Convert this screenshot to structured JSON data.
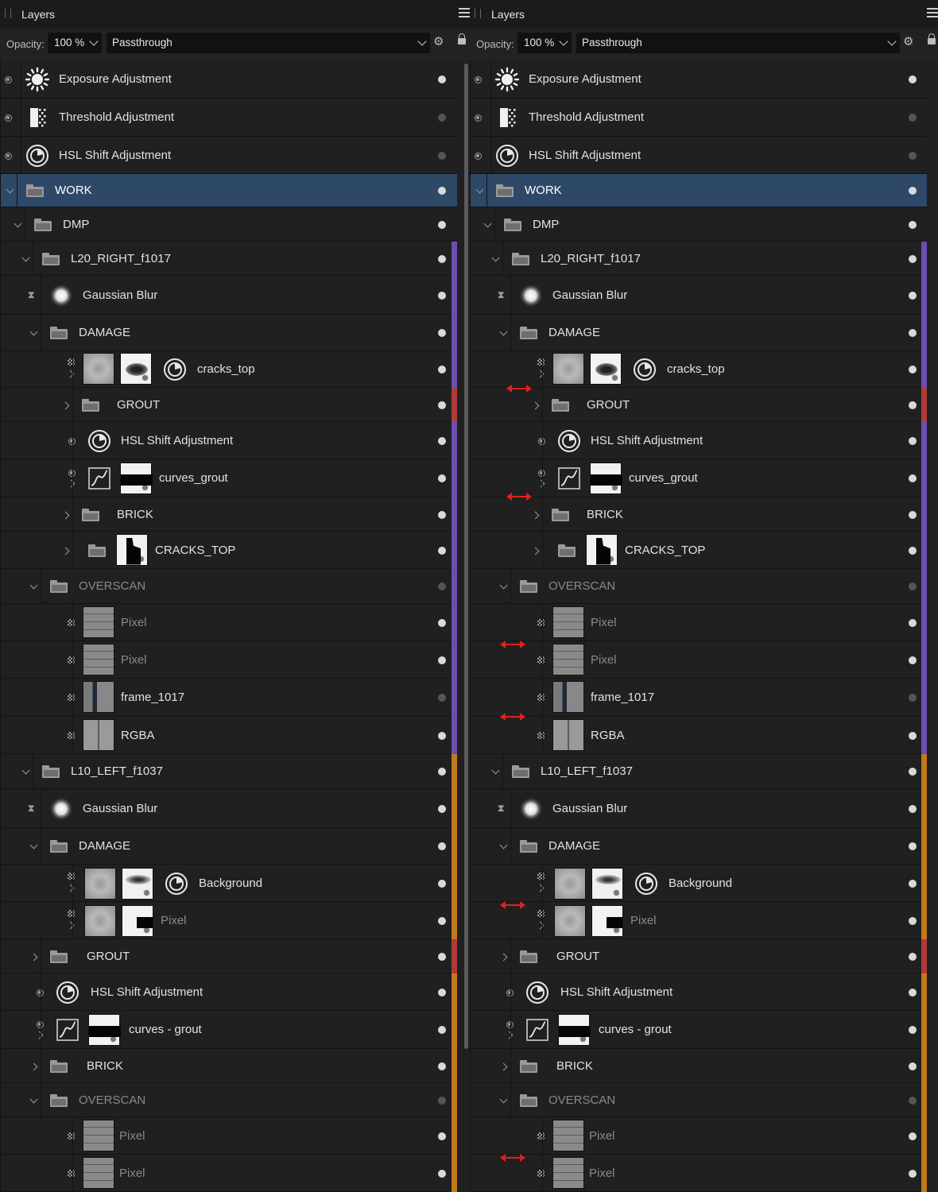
{
  "colors": {
    "selected_row": "#2e4868",
    "tag_purple": "#6b4fb0",
    "tag_red": "#b03a3a",
    "tag_orange": "#c07a1c",
    "arrow": "#e02020"
  },
  "panels": [
    {
      "title": "Layers",
      "opacity_label": "Opacity:",
      "opacity_value": "100 %",
      "blend_mode": "Passthrough",
      "layers": [
        {
          "name": "Exposure Adjustment",
          "icon": "exposure-icon"
        },
        {
          "name": "Threshold Adjustment",
          "icon": "threshold-icon"
        },
        {
          "name": "HSL Shift Adjustment",
          "icon": "hsl-icon"
        },
        {
          "name": "WORK",
          "icon": "folder-icon",
          "selected": true
        },
        {
          "name": "DMP",
          "icon": "folder-icon"
        },
        {
          "name": "L20_RIGHT_f1017",
          "icon": "folder-icon"
        },
        {
          "name": "Gaussian Blur",
          "icon": "blur-icon"
        },
        {
          "name": "DAMAGE",
          "icon": "folder-icon"
        },
        {
          "name": "cracks_top",
          "icon": "hsl-icon"
        },
        {
          "name": "GROUT",
          "icon": "folder-icon"
        },
        {
          "name": "HSL Shift Adjustment",
          "icon": "hsl-icon"
        },
        {
          "name": "curves_grout",
          "icon": "curves-icon"
        },
        {
          "name": "BRICK",
          "icon": "folder-icon"
        },
        {
          "name": "CRACKS_TOP",
          "icon": "folder-icon"
        },
        {
          "name": "OVERSCAN",
          "icon": "folder-icon"
        },
        {
          "name": "Pixel",
          "icon": "pixel-thumb"
        },
        {
          "name": "Pixel",
          "icon": "pixel-thumb"
        },
        {
          "name": "frame_1017",
          "icon": "frame-thumb"
        },
        {
          "name": "RGBA",
          "icon": "rgba-thumb"
        },
        {
          "name": "L10_LEFT_f1037",
          "icon": "folder-icon"
        },
        {
          "name": "Gaussian Blur",
          "icon": "blur-icon"
        },
        {
          "name": "DAMAGE",
          "icon": "folder-icon"
        },
        {
          "name": "Background",
          "icon": "hsl-icon"
        },
        {
          "name": "Pixel",
          "icon": "pixel-thumb"
        },
        {
          "name": "GROUT",
          "icon": "folder-icon"
        },
        {
          "name": "HSL Shift Adjustment",
          "icon": "hsl-icon"
        },
        {
          "name": "curves - grout",
          "icon": "curves-icon"
        },
        {
          "name": "BRICK",
          "icon": "folder-icon"
        },
        {
          "name": "OVERSCAN",
          "icon": "folder-icon"
        },
        {
          "name": "Pixel",
          "icon": "pixel-thumb"
        },
        {
          "name": "Pixel",
          "icon": "pixel-thumb"
        }
      ]
    },
    {
      "title": "Layers",
      "opacity_label": "Opacity:",
      "opacity_value": "100 %",
      "blend_mode": "Passthrough",
      "layers": [
        {
          "name": "Exposure Adjustment",
          "icon": "exposure-icon"
        },
        {
          "name": "Threshold Adjustment",
          "icon": "threshold-icon"
        },
        {
          "name": "HSL Shift Adjustment",
          "icon": "hsl-icon"
        },
        {
          "name": "WORK",
          "icon": "folder-icon",
          "selected": true
        },
        {
          "name": "DMP",
          "icon": "folder-icon"
        },
        {
          "name": "L20_RIGHT_f1017",
          "icon": "folder-icon"
        },
        {
          "name": "Gaussian Blur",
          "icon": "blur-icon"
        },
        {
          "name": "DAMAGE",
          "icon": "folder-icon"
        },
        {
          "name": "cracks_top",
          "icon": "hsl-icon"
        },
        {
          "name": "GROUT",
          "icon": "folder-icon"
        },
        {
          "name": "HSL Shift Adjustment",
          "icon": "hsl-icon"
        },
        {
          "name": "curves_grout",
          "icon": "curves-icon"
        },
        {
          "name": "BRICK",
          "icon": "folder-icon"
        },
        {
          "name": "CRACKS_TOP",
          "icon": "folder-icon"
        },
        {
          "name": "OVERSCAN",
          "icon": "folder-icon"
        },
        {
          "name": "Pixel",
          "icon": "pixel-thumb"
        },
        {
          "name": "Pixel",
          "icon": "pixel-thumb"
        },
        {
          "name": "frame_1017",
          "icon": "frame-thumb"
        },
        {
          "name": "RGBA",
          "icon": "rgba-thumb"
        },
        {
          "name": "L10_LEFT_f1037",
          "icon": "folder-icon"
        },
        {
          "name": "Gaussian Blur",
          "icon": "blur-icon"
        },
        {
          "name": "DAMAGE",
          "icon": "folder-icon"
        },
        {
          "name": "Background",
          "icon": "hsl-icon"
        },
        {
          "name": "Pixel",
          "icon": "pixel-thumb"
        },
        {
          "name": "GROUT",
          "icon": "folder-icon"
        },
        {
          "name": "HSL Shift Adjustment",
          "icon": "hsl-icon"
        },
        {
          "name": "curves - grout",
          "icon": "curves-icon"
        },
        {
          "name": "BRICK",
          "icon": "folder-icon"
        },
        {
          "name": "OVERSCAN",
          "icon": "folder-icon"
        },
        {
          "name": "Pixel",
          "icon": "pixel-thumb"
        },
        {
          "name": "Pixel",
          "icon": "pixel-thumb"
        }
      ]
    }
  ]
}
